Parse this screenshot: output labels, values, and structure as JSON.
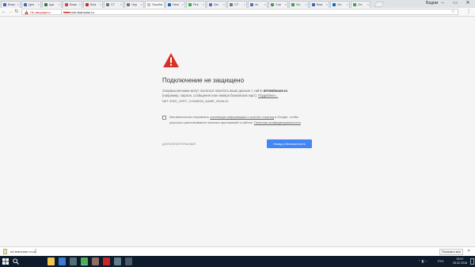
{
  "browser": {
    "tabs": [
      {
        "label": "Влас",
        "favicon_color": "#3b67b8"
      },
      {
        "label": "Ден",
        "favicon_color": "#3b67b8"
      },
      {
        "label": "кра",
        "favicon_color": "#2e7d32"
      },
      {
        "label": "Влас",
        "favicon_color": "#e53935"
      },
      {
        "label": "Вла",
        "favicon_color": "#c62828"
      },
      {
        "label": "СТ",
        "favicon_color": "#757575"
      },
      {
        "label": "Чер",
        "favicon_color": "#8d6e63"
      },
      {
        "label": "Ошибк",
        "favicon_color": "#bdbdbd",
        "active": true
      },
      {
        "label": "Нем",
        "favicon_color": "#1565c0"
      },
      {
        "label": "Рек",
        "favicon_color": "#43a047"
      },
      {
        "label": "Заг",
        "favicon_color": "#5c6bc0"
      },
      {
        "label": "СТ",
        "favicon_color": "#757575"
      },
      {
        "label": "vk",
        "favicon_color": "#4a76a8"
      },
      {
        "label": "Сче",
        "favicon_color": "#43a047"
      },
      {
        "label": "Ол",
        "favicon_color": "#43a047"
      },
      {
        "label": "Вла",
        "favicon_color": "#3b67b8"
      },
      {
        "label": "Ол",
        "favicon_color": "#1565c0"
      },
      {
        "label": "Ол",
        "favicon_color": "#43a047"
      }
    ],
    "profile_name": "Вадим",
    "window_controls": {
      "minimize": "–",
      "maximize": "▭",
      "close": "✕"
    },
    "address_bar": {
      "security_label": "Не защищено",
      "scheme": "https",
      "host": "://mt-teahouse.ru"
    }
  },
  "interstitial": {
    "title": "Подключение не защищено",
    "body_prefix": "Злоумышленники могут пытаться похитить ваши данные с сайта",
    "body_domain": "mt-teahouse.ru",
    "body_suffix": "(например, пароли, сообщения или номера банковских карт).",
    "privacy_link": "Подробнее...",
    "error_code": "NET::ERR_CERT_COMMON_NAME_INVALID",
    "optin_prefix": "Автоматически отправлять",
    "optin_link": "системную информацию и контент страниц",
    "optin_mid": "в Google, чтобы",
    "optin_line2": "улучшить распознавание опасных приложений и сайтов.",
    "policy_link": "Политика конфиденциальности",
    "advanced_label": "ДОПОЛНИТЕЛЬНЫЕ",
    "back_button": "Назад к безопасности"
  },
  "download_shelf": {
    "filename": "mt-teahouse.ru.zip",
    "show_all": "Показать все"
  },
  "taskbar": {
    "apps": [
      {
        "name": "file-explorer",
        "color": "#f3c74f"
      },
      {
        "name": "store",
        "color": "#3a7bd5"
      },
      {
        "name": "media-player",
        "color": "#546e7a"
      },
      {
        "name": "chrome",
        "color": "#4caf50",
        "active": true
      },
      {
        "name": "app-5",
        "color": "#8d6e63"
      },
      {
        "name": "filezilla",
        "color": "#c62828"
      },
      {
        "name": "app-7",
        "color": "#607d8b"
      },
      {
        "name": "app-8",
        "color": "#455a64"
      }
    ],
    "language": "РУС",
    "time": "09:07",
    "date": "28.02.2018"
  }
}
